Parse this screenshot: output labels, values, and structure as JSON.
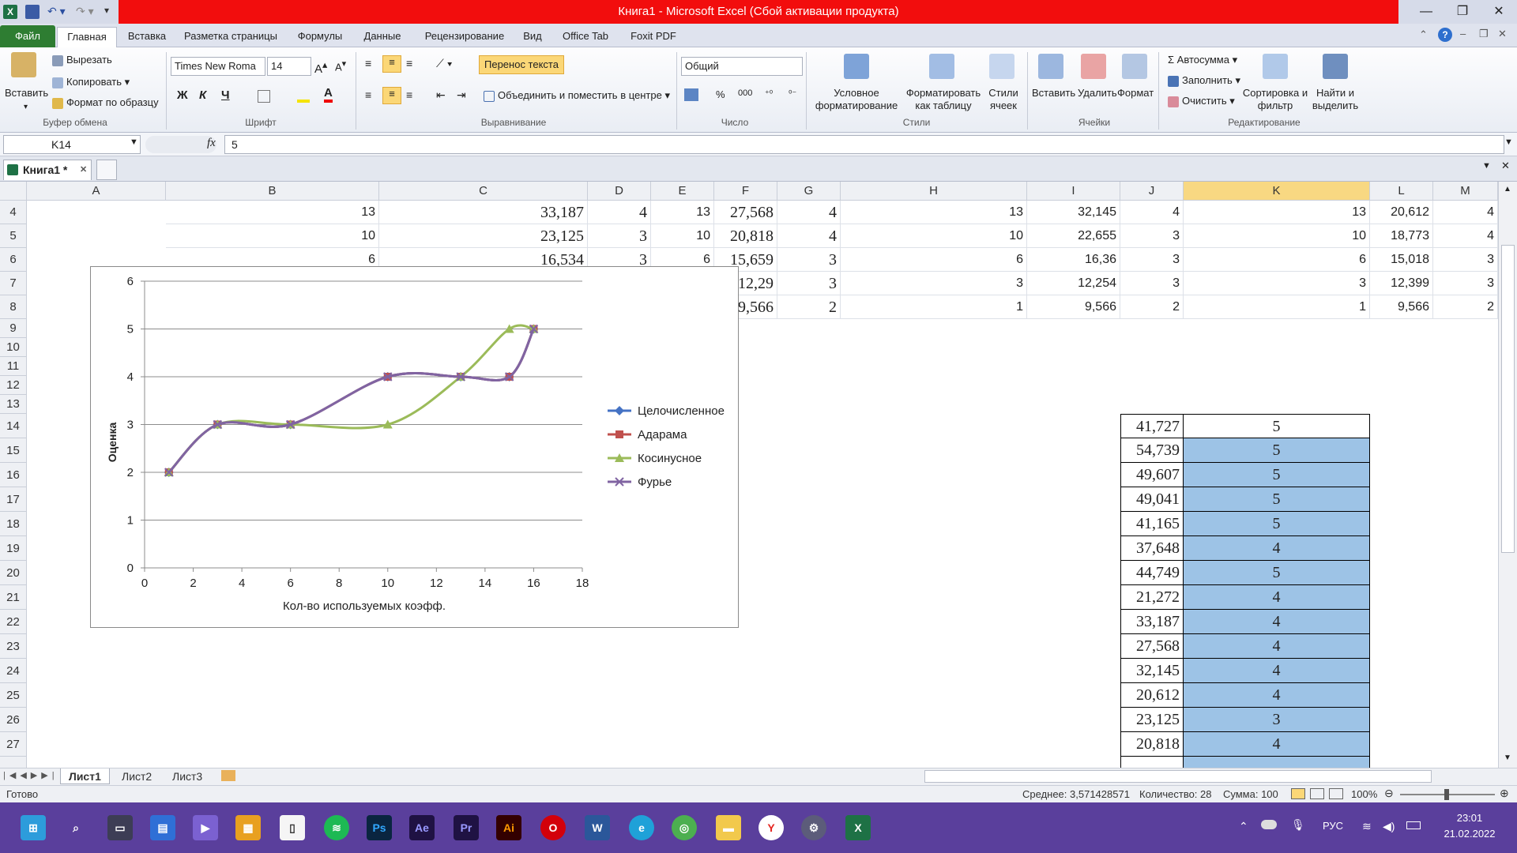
{
  "window": {
    "title": "Книга1  -  Microsoft Excel (Сбой активации продукта)"
  },
  "ribbon_tabs": [
    "Файл",
    "Главная",
    "Вставка",
    "Разметка страницы",
    "Формулы",
    "Данные",
    "Рецензирование",
    "Вид",
    "Office Tab",
    "Foxit PDF"
  ],
  "clipboard": {
    "paste": "Вставить",
    "cut": "Вырезать",
    "copy": "Копировать",
    "format_painter": "Формат по образцу",
    "label": "Буфер обмена"
  },
  "font": {
    "name": "Times New Roma",
    "size": "14",
    "bold": "Ж",
    "italic": "К",
    "underline": "Ч",
    "label": "Шрифт"
  },
  "alignment": {
    "wrap": "Перенос текста",
    "merge": "Объединить и поместить в центре",
    "label": "Выравнивание"
  },
  "number": {
    "format": "Общий",
    "percent": "%",
    "thousands": "000",
    "label": "Число"
  },
  "styles": {
    "conditional": "Условное форматирование",
    "as_table": "Форматировать как таблицу",
    "cell_styles": "Стили ячеек",
    "label": "Стили"
  },
  "cells": {
    "insert": "Вставить",
    "delete": "Удалить",
    "format": "Формат",
    "label": "Ячейки"
  },
  "editing": {
    "autosum": "Автосумма",
    "fill": "Заполнить",
    "clear": "Очистить",
    "sort": "Сортировка и фильтр",
    "find": "Найти и выделить",
    "label": "Редактирование"
  },
  "formula_bar": {
    "name_box": "K14",
    "fx": "fx",
    "value": "5"
  },
  "workbook_tab": "Книга1 *",
  "columns": [
    "A",
    "B",
    "C",
    "D",
    "E",
    "F",
    "G",
    "H",
    "I",
    "J",
    "K",
    "L",
    "M"
  ],
  "rows_top": [
    {
      "num": "4",
      "B": "13",
      "C": "33,187",
      "D": "4",
      "E": "13",
      "F": "27,568",
      "G": "4",
      "H": "13",
      "I": "32,145",
      "J": "4",
      "K": "13",
      "L": "20,612",
      "M": "4"
    },
    {
      "num": "5",
      "B": "10",
      "C": "23,125",
      "D": "3",
      "E": "10",
      "F": "20,818",
      "G": "4",
      "H": "10",
      "I": "22,655",
      "J": "3",
      "K": "10",
      "L": "18,773",
      "M": "4"
    },
    {
      "num": "6",
      "B": "6",
      "C": "16,534",
      "D": "3",
      "E": "6",
      "F": "15,659",
      "G": "3",
      "H": "6",
      "I": "16,36",
      "J": "3",
      "K": "6",
      "L": "15,018",
      "M": "3"
    },
    {
      "num": "7",
      "B": "",
      "C": "",
      "D": "",
      "E": "",
      "F": "12,29",
      "G": "3",
      "H": "3",
      "I": "12,254",
      "J": "3",
      "K": "3",
      "L": "12,399",
      "M": "3"
    },
    {
      "num": "8",
      "B": "",
      "C": "",
      "D": "",
      "E": "",
      "F": "9,566",
      "G": "2",
      "H": "1",
      "I": "9,566",
      "J": "2",
      "K": "1",
      "L": "9,566",
      "M": "2"
    }
  ],
  "rows_bottom": [
    {
      "num": "14",
      "J": "41,727",
      "K": "5"
    },
    {
      "num": "15",
      "J": "54,739",
      "K": "5"
    },
    {
      "num": "16",
      "J": "49,607",
      "K": "5"
    },
    {
      "num": "17",
      "J": "49,041",
      "K": "5"
    },
    {
      "num": "18",
      "J": "41,165",
      "K": "5"
    },
    {
      "num": "19",
      "J": "37,648",
      "K": "4"
    },
    {
      "num": "20",
      "J": "44,749",
      "K": "5"
    },
    {
      "num": "21",
      "J": "21,272",
      "K": "4"
    },
    {
      "num": "22",
      "J": "33,187",
      "K": "4"
    },
    {
      "num": "23",
      "J": "27,568",
      "K": "4"
    },
    {
      "num": "24",
      "J": "32,145",
      "K": "4"
    },
    {
      "num": "25",
      "J": "20,612",
      "K": "4"
    },
    {
      "num": "26",
      "J": "23,125",
      "K": "3"
    },
    {
      "num": "27",
      "J": "20,818",
      "K": "4"
    }
  ],
  "chart_data": {
    "type": "line",
    "xlabel": "Кол-во используемых коэфф.",
    "ylabel": "Оценка",
    "xlim": [
      0,
      18
    ],
    "ylim": [
      0,
      6
    ],
    "xticks": [
      0,
      2,
      4,
      6,
      8,
      10,
      12,
      14,
      16,
      18
    ],
    "yticks": [
      0,
      1,
      2,
      3,
      4,
      5,
      6
    ],
    "grid": "horizontal",
    "legend": "right",
    "series": [
      {
        "name": "Целочисленное",
        "color": "#4472c4",
        "marker": "diamond",
        "x": [
          1,
          3,
          6,
          10,
          13,
          15,
          16
        ],
        "y": [
          2,
          3,
          3,
          4,
          4,
          4,
          5
        ]
      },
      {
        "name": "Адарама",
        "color": "#c0504d",
        "marker": "square",
        "x": [
          1,
          3,
          6,
          10,
          13,
          15,
          16
        ],
        "y": [
          2,
          3,
          3,
          4,
          4,
          4,
          5
        ]
      },
      {
        "name": "Косинусное",
        "color": "#9bbb59",
        "marker": "triangle",
        "x": [
          1,
          3,
          6,
          10,
          13,
          15,
          16
        ],
        "y": [
          2,
          3,
          3,
          3,
          4,
          5,
          5
        ]
      },
      {
        "name": "Фурье",
        "color": "#8064a2",
        "marker": "x",
        "x": [
          1,
          3,
          6,
          10,
          13,
          15,
          16
        ],
        "y": [
          2,
          3,
          3,
          4,
          4,
          4,
          5
        ]
      }
    ]
  },
  "sheets": [
    "Лист1",
    "Лист2",
    "Лист3"
  ],
  "status": {
    "ready": "Готово",
    "average": "Среднее: 3,571428571",
    "count": "Количество: 28",
    "sum": "Сумма: 100",
    "zoom": "100%"
  },
  "tray": {
    "lang": "РУС",
    "time": "23:01",
    "date": "21.02.2022"
  }
}
